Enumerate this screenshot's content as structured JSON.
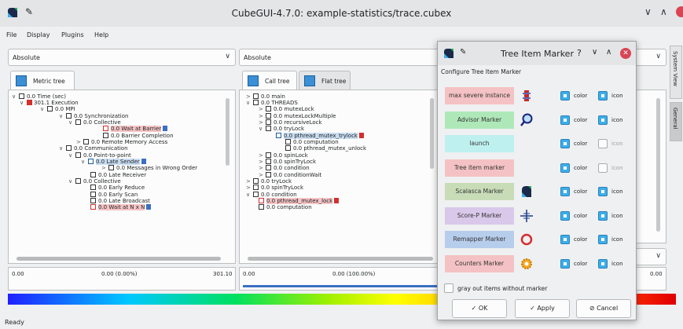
{
  "window": {
    "title": "CubeGUI-4.7.0: example-statistics/trace.cubex"
  },
  "menu": [
    "File",
    "Display",
    "Plugins",
    "Help"
  ],
  "left_panel": {
    "combo": "Absolute",
    "tab": "Metric tree",
    "rows": [
      "0.0 Time (sec)",
      "301.1 Execution",
      "0.0 MPI",
      "0.0 Synchronization",
      "0.0 Collective",
      "0.0 Wait at Barrier",
      "0.0 Barrier Completion",
      "0.0 Remote Memory Access",
      "0.0 Communication",
      "0.0 Point-to-point",
      "0.0 Late Sender",
      "0.0 Messages in Wrong Order",
      "0.0 Late Receiver",
      "0.0 Collective",
      "0.0 Early Reduce",
      "0.0 Early Scan",
      "0.0 Late Broadcast",
      "0.0 Wait at N x N"
    ],
    "bar": {
      "min": "0.00",
      "mid": "0.00 (0.00%)",
      "max": "301.10"
    }
  },
  "mid_panel": {
    "combo": "Absolute",
    "tabs": [
      "Call tree",
      "Flat tree"
    ],
    "rows": [
      "0.0 main",
      "0.0 THREADS",
      "0.0 mutexLock",
      "0.0 mutexLockMultiple",
      "0.0 recursiveLock",
      "0.0 tryLock",
      "0.0 pthread_mutex_trylock",
      "0.0 computation",
      "0.0 pthread_mutex_unlock",
      "0.0 spinLock",
      "0.0 spinTryLock",
      "0.0 condition",
      "0.0 conditionWait",
      "0.0 tryLock",
      "0.0 spinTryLock",
      "0.0 condition",
      "0.0 pthread_mutex_lock",
      "0.0 computation"
    ],
    "bar": {
      "min": "0.00",
      "mid": "0.00 (100.00%)"
    }
  },
  "right_panel": {
    "bar_max": "0.00",
    "tabs": [
      "System View",
      "General"
    ]
  },
  "status": "Ready",
  "dialog": {
    "title": "Tree Item Marker",
    "title_buttons": [
      "?",
      "∨",
      "∧"
    ],
    "heading": "Configure Tree Item Marker",
    "markers": [
      {
        "label": "max severe instance",
        "bg": "#f4c2c4",
        "icon": "red-bar-icon",
        "color_on": true,
        "icon_on": true
      },
      {
        "label": "Advisor Marker",
        "bg": "#aee8b8",
        "icon": "magnifier-icon",
        "color_on": true,
        "icon_on": true
      },
      {
        "label": "launch",
        "bg": "#bff0f0",
        "icon": "",
        "color_on": true,
        "icon_on": false
      },
      {
        "label": "Tree item marker",
        "bg": "#f4c2c4",
        "icon": "",
        "color_on": true,
        "icon_on": false
      },
      {
        "label": "Scalasca Marker",
        "bg": "#c8dcb8",
        "icon": "scalasca-logo-icon",
        "color_on": true,
        "icon_on": true
      },
      {
        "label": "Score-P Marker",
        "bg": "#d9c8ea",
        "icon": "crosshair-icon",
        "color_on": true,
        "icon_on": true
      },
      {
        "label": "Remapper Marker",
        "bg": "#b7cdec",
        "icon": "red-ring-icon",
        "color_on": true,
        "icon_on": true
      },
      {
        "label": "Counters Marker",
        "bg": "#f4c2c4",
        "icon": "gear-icon",
        "color_on": true,
        "icon_on": true
      }
    ],
    "color_label": "color",
    "icon_label": "icon",
    "gray_out": "gray out items without marker",
    "ok": "OK",
    "apply": "Apply",
    "cancel": "Cancel"
  }
}
